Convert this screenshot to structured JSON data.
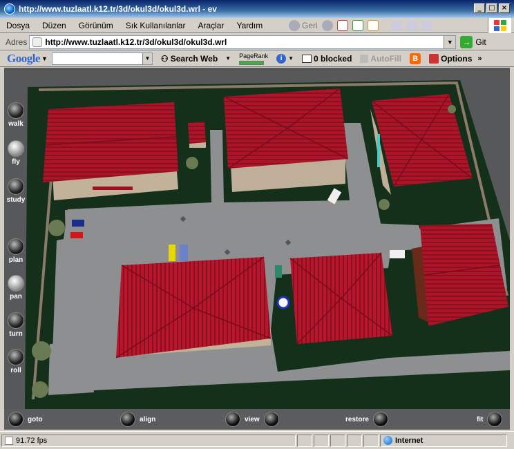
{
  "window": {
    "title": "http://www.tuzlaatl.k12.tr/3d/okul3d/okul3d.wrl - ev",
    "minimize": "_",
    "maximize": "□",
    "close": "×"
  },
  "menu": [
    "Dosya",
    "Düzen",
    "Görünüm",
    "Sık Kullanılanlar",
    "Araçlar",
    "Yardım"
  ],
  "toolbar": {
    "back_label": "Geri"
  },
  "address": {
    "label": "Adres",
    "url": "http://www.tuzlaatl.k12.tr/3d/okul3d/okul3d.wrl",
    "go_label": "Git"
  },
  "google_bar": {
    "logo": "Google",
    "search_web": "Search Web",
    "pagerank": "PageRank",
    "blocked": "0 blocked",
    "autofill": "AutoFill",
    "options": "Options"
  },
  "viewer": {
    "nav_buttons": [
      {
        "label": "walk"
      },
      {
        "label": "fly"
      },
      {
        "label": "study"
      },
      {
        "label": "plan"
      },
      {
        "label": "pan"
      },
      {
        "label": "turn"
      },
      {
        "label": "roll"
      }
    ],
    "bottom_buttons": {
      "goto": "goto",
      "align": "align",
      "view": "view",
      "restore": "restore",
      "fit": "fit"
    },
    "active_mode": "fly"
  },
  "status": {
    "fps": "91.72 fps",
    "zone": "Internet"
  },
  "colors": {
    "roof": "#b0142c",
    "grass": "#14301a",
    "road": "#8e8f91",
    "wall": "#bfae98",
    "titlebar": "#0a246a"
  }
}
